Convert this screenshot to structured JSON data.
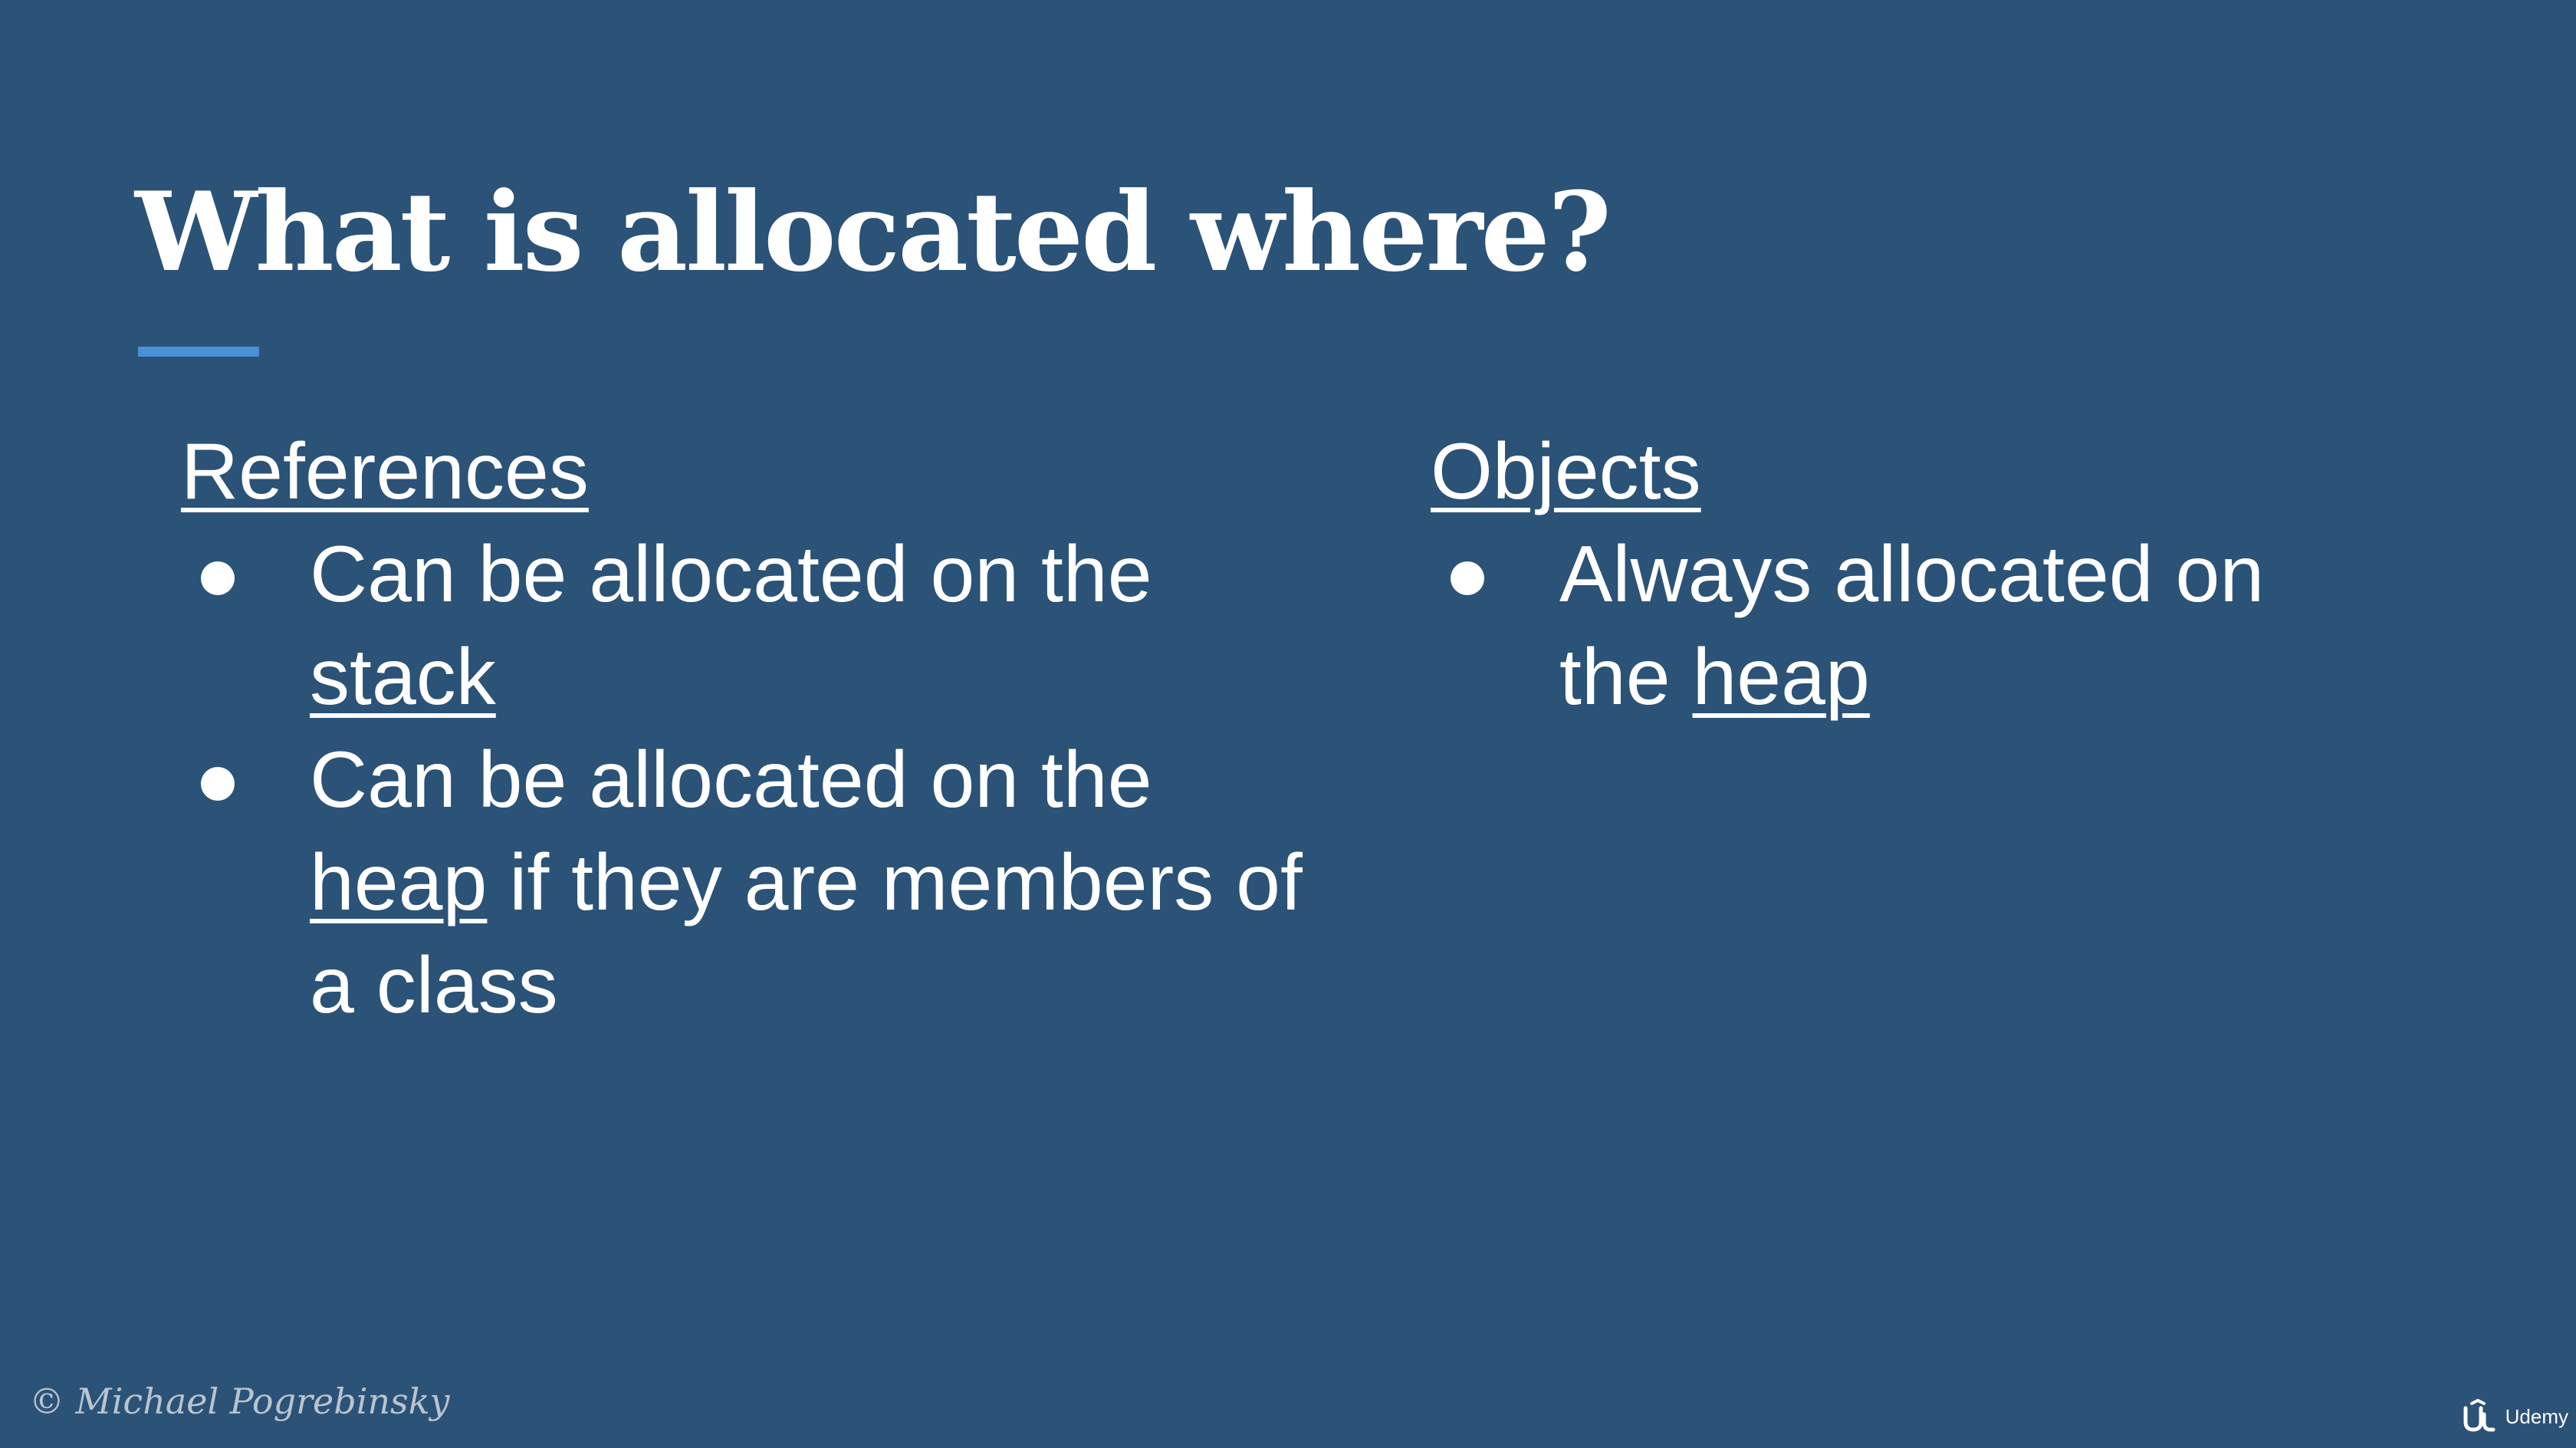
{
  "slide": {
    "title": "What is allocated where?",
    "accent_color": "#4a90d9",
    "background_color": "#2b5277"
  },
  "references": {
    "heading": "References",
    "bullets": [
      {
        "prefix": "Can be allocated on the ",
        "underlined": "stack",
        "suffix": ""
      },
      {
        "prefix": "Can be allocated on the ",
        "underlined": "heap",
        "suffix": " if they are members of a class"
      }
    ]
  },
  "objects": {
    "heading": "Objects",
    "bullets": [
      {
        "prefix": "Always allocated on the ",
        "underlined": "heap",
        "suffix": ""
      }
    ]
  },
  "footer": {
    "copyright": "© Michael Pogrebinsky",
    "brand_icon": "udemy-logo-icon",
    "brand": "Udemy"
  }
}
